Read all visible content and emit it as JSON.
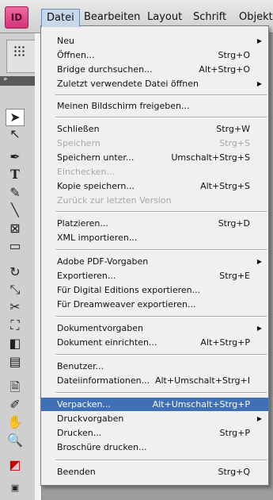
{
  "app": {
    "logo": "ID"
  },
  "menubar": [
    "Datei",
    "Bearbeiten",
    "Layout",
    "Schrift",
    "Objekt"
  ],
  "menu": {
    "items": [
      {
        "label": "Neu",
        "shortcut": "",
        "submenu": true,
        "disabled": false
      },
      {
        "label": "Öffnen...",
        "shortcut": "Strg+O",
        "submenu": false,
        "disabled": false
      },
      {
        "label": "Bridge durchsuchen...",
        "shortcut": "Alt+Strg+O",
        "submenu": false,
        "disabled": false
      },
      {
        "label": "Zuletzt verwendete Datei öffnen",
        "shortcut": "",
        "submenu": true,
        "disabled": false
      },
      {
        "label": "Meinen Bildschirm freigeben...",
        "shortcut": "",
        "submenu": false,
        "disabled": false
      },
      {
        "label": "Schließen",
        "shortcut": "Strg+W",
        "submenu": false,
        "disabled": false
      },
      {
        "label": "Speichern",
        "shortcut": "Strg+S",
        "submenu": false,
        "disabled": true
      },
      {
        "label": "Speichern unter...",
        "shortcut": "Umschalt+Strg+S",
        "submenu": false,
        "disabled": false
      },
      {
        "label": "Einchecken...",
        "shortcut": "",
        "submenu": false,
        "disabled": true
      },
      {
        "label": "Kopie speichern...",
        "shortcut": "Alt+Strg+S",
        "submenu": false,
        "disabled": false
      },
      {
        "label": "Zurück zur letzten Version",
        "shortcut": "",
        "submenu": false,
        "disabled": true
      },
      {
        "label": "Platzieren...",
        "shortcut": "Strg+D",
        "submenu": false,
        "disabled": false
      },
      {
        "label": "XML importieren...",
        "shortcut": "",
        "submenu": false,
        "disabled": false
      },
      {
        "label": "Adobe PDF-Vorgaben",
        "shortcut": "",
        "submenu": true,
        "disabled": false
      },
      {
        "label": "Exportieren...",
        "shortcut": "Strg+E",
        "submenu": false,
        "disabled": false
      },
      {
        "label": "Für Digital Editions exportieren...",
        "shortcut": "",
        "submenu": false,
        "disabled": false
      },
      {
        "label": "Für Dreamweaver exportieren...",
        "shortcut": "",
        "submenu": false,
        "disabled": false
      },
      {
        "label": "Dokumentvorgaben",
        "shortcut": "",
        "submenu": true,
        "disabled": false
      },
      {
        "label": "Dokument einrichten...",
        "shortcut": "Alt+Strg+P",
        "submenu": false,
        "disabled": false
      },
      {
        "label": "Benutzer...",
        "shortcut": "",
        "submenu": false,
        "disabled": false
      },
      {
        "label": "Dateiinformationen...",
        "shortcut": "Alt+Umschalt+Strg+I",
        "submenu": false,
        "disabled": false
      },
      {
        "label": "Verpacken...",
        "shortcut": "Alt+Umschalt+Strg+P",
        "submenu": false,
        "disabled": false,
        "highlighted": true
      },
      {
        "label": "Druckvorgaben",
        "shortcut": "",
        "submenu": true,
        "disabled": false
      },
      {
        "label": "Drucken...",
        "shortcut": "Strg+P",
        "submenu": false,
        "disabled": false
      },
      {
        "label": "Broschüre drucken...",
        "shortcut": "",
        "submenu": false,
        "disabled": false
      },
      {
        "label": "Beenden",
        "shortcut": "Strg+Q",
        "submenu": false,
        "disabled": false
      }
    ]
  },
  "tools": [
    "selection-tool-icon",
    "direct-selection-tool-icon",
    "pen-tool-icon",
    "type-tool-icon",
    "pencil-tool-icon",
    "line-tool-icon",
    "rectangle-frame-tool-icon",
    "rectangle-tool-icon",
    "rotate-tool-icon",
    "scale-tool-icon",
    "scissors-tool-icon",
    "free-transform-tool-icon",
    "gradient-tool-icon",
    "gradient-feather-tool-icon",
    "note-tool-icon",
    "eyedropper-tool-icon",
    "hand-tool-icon",
    "zoom-tool-icon",
    "fill-stroke-icon",
    "view-mode-icon"
  ]
}
